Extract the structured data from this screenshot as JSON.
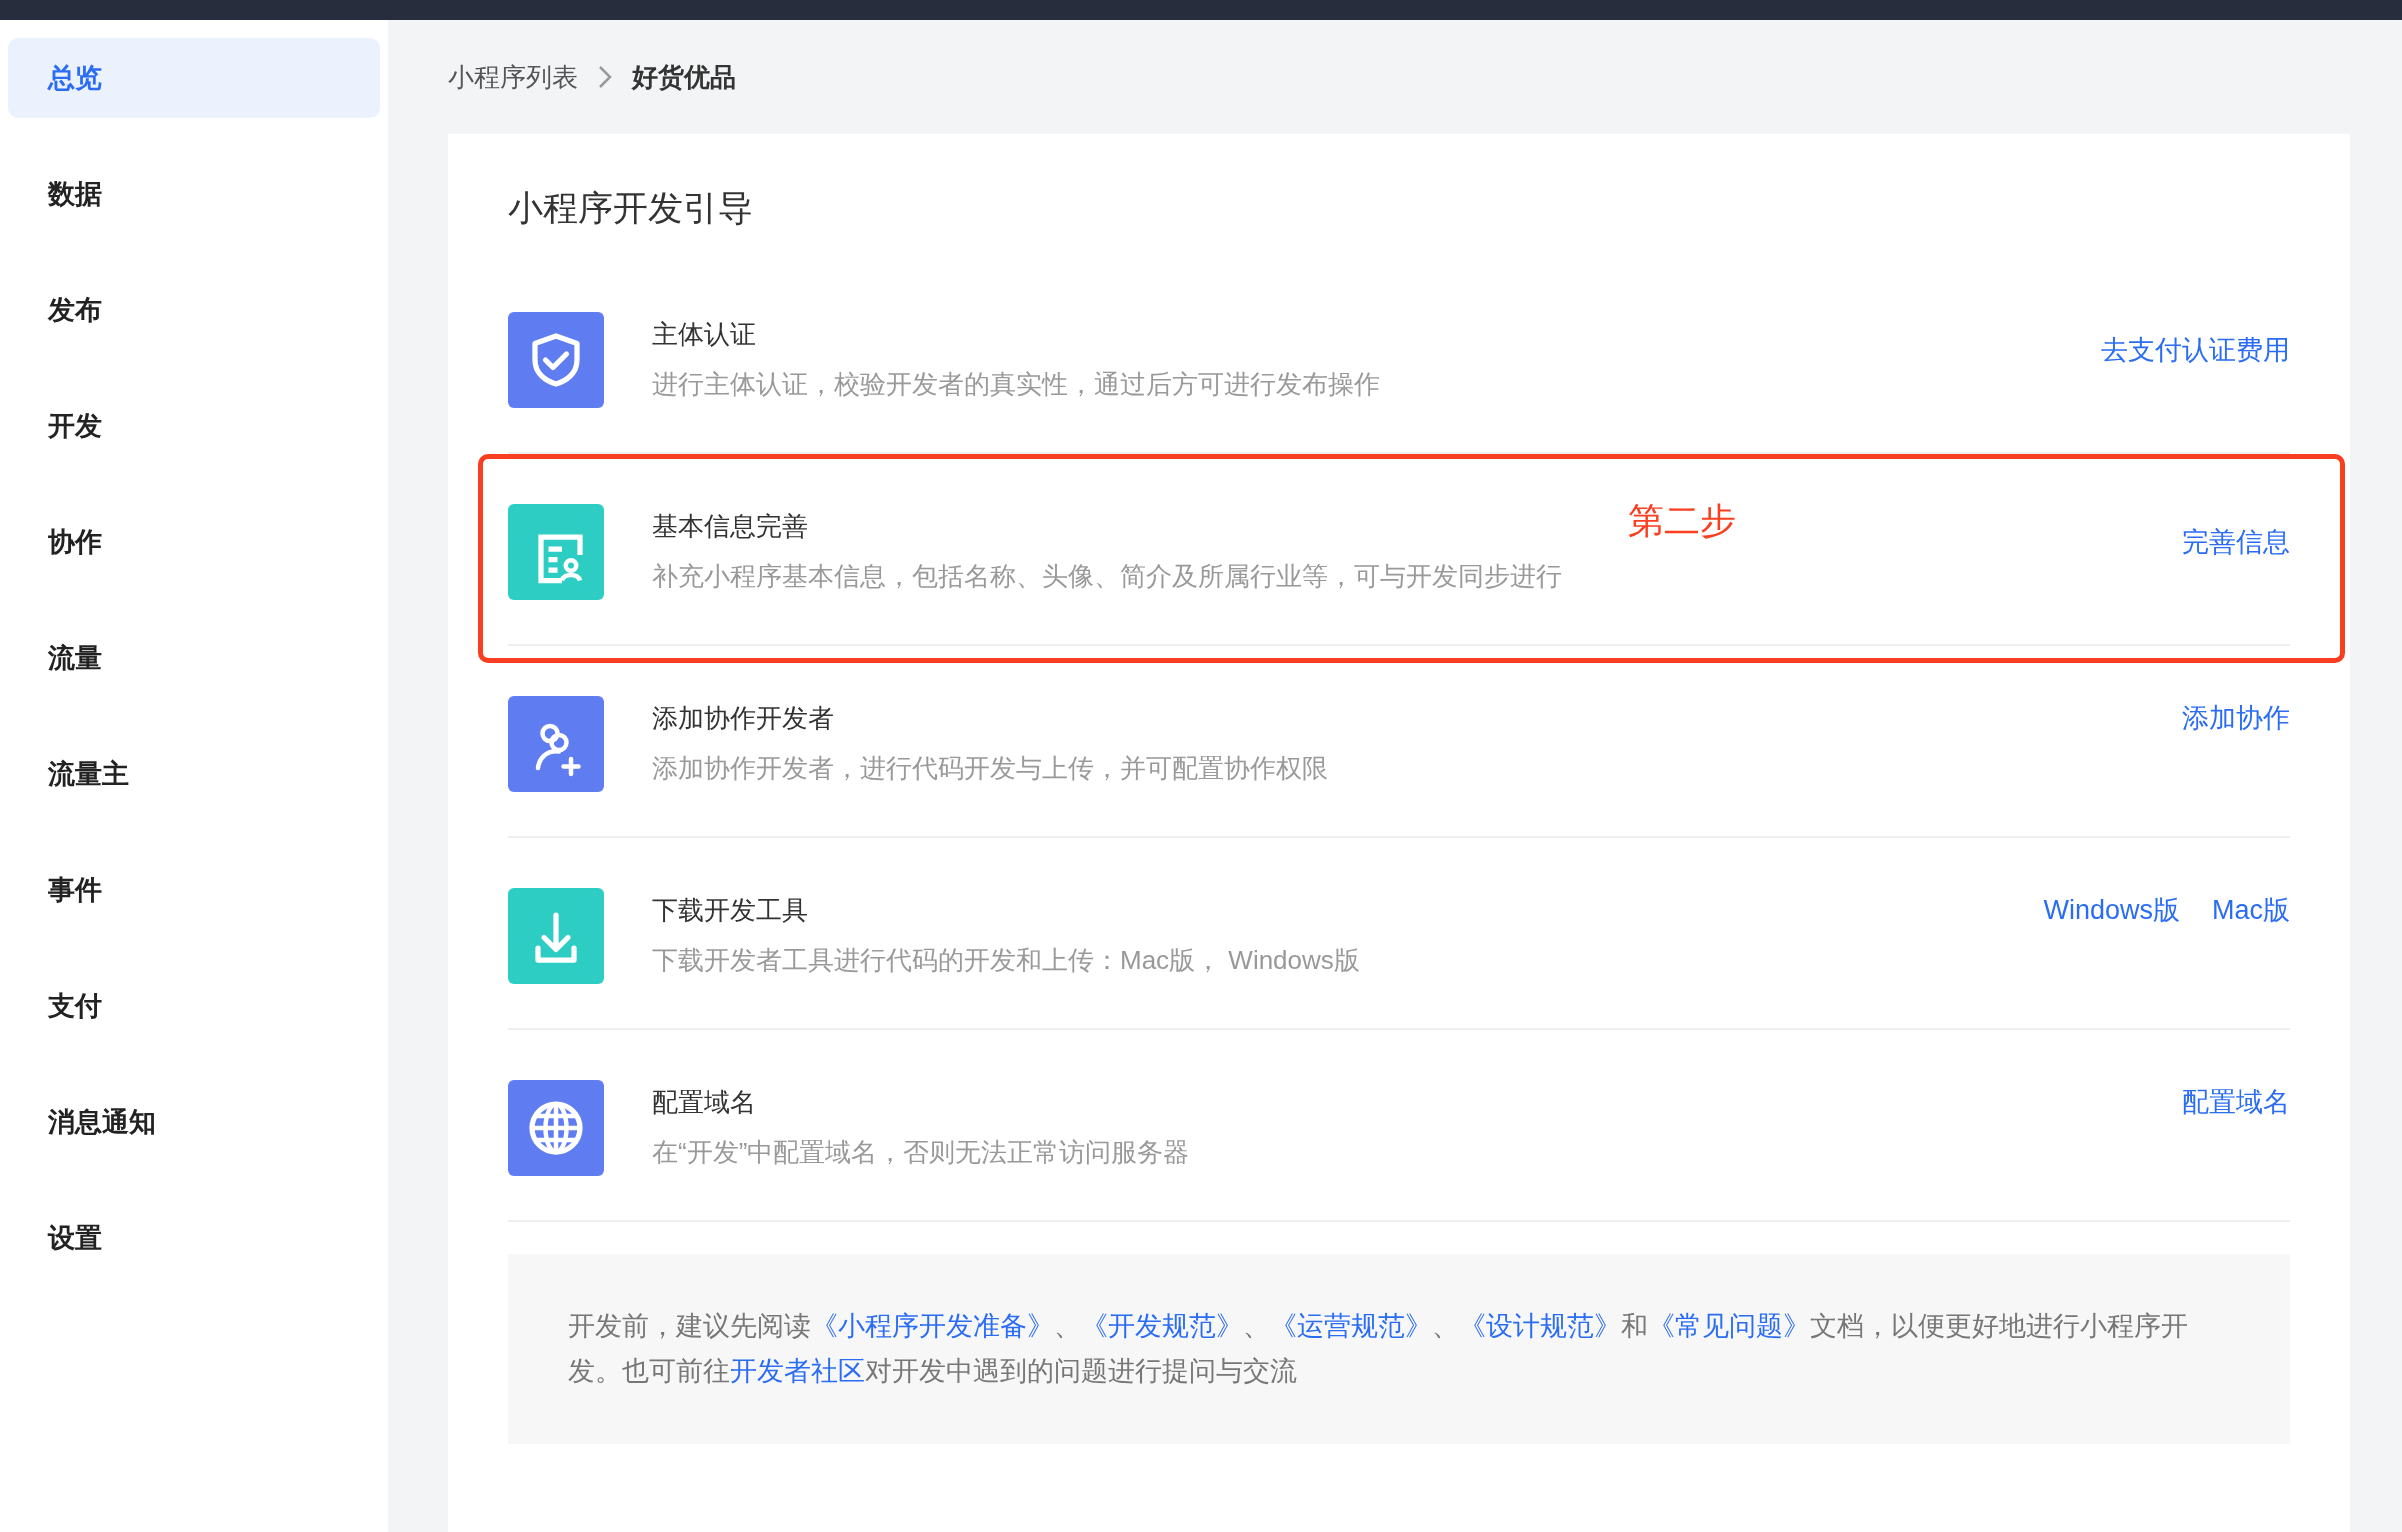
{
  "sidebar": {
    "items": [
      {
        "label": "总览",
        "selected": true
      },
      {
        "label": "数据",
        "selected": false
      },
      {
        "label": "发布",
        "selected": false
      },
      {
        "label": "开发",
        "selected": false
      },
      {
        "label": "协作",
        "selected": false
      },
      {
        "label": "流量",
        "selected": false
      },
      {
        "label": "流量主",
        "selected": false
      },
      {
        "label": "事件",
        "selected": false
      },
      {
        "label": "支付",
        "selected": false
      },
      {
        "label": "消息通知",
        "selected": false
      },
      {
        "label": "设置",
        "selected": false
      }
    ]
  },
  "breadcrumb": [
    "小程序列表",
    "好货优品"
  ],
  "guide": {
    "title": "小程序开发引导",
    "steps": [
      {
        "kind": "shield",
        "color": "#5f7cf1",
        "title": "主体认证",
        "description": "进行主体认证，校验开发者的真实性，通过后方可进行发布操作",
        "links": [
          "去支付认证费用"
        ]
      },
      {
        "kind": "profile",
        "color": "#2ecdc4",
        "title": "基本信息完善",
        "description": "补充小程序基本信息，包括名称、头像、简介及所属行业等，可与开发同步进行",
        "links": [
          "完善信息"
        ],
        "annotation": "第二步"
      },
      {
        "kind": "users",
        "color": "#5f7cf1",
        "title": "添加协作开发者",
        "description": "添加协作开发者，进行代码开发与上传，并可配置协作权限",
        "links": [
          "添加协作"
        ]
      },
      {
        "kind": "download",
        "color": "#2ecdc4",
        "title": "下载开发工具",
        "description": "下载开发者工具进行代码的开发和上传：Mac版， Windows版",
        "links": [
          "Windows版",
          "Mac版"
        ]
      },
      {
        "kind": "globe",
        "color": "#5f7cf1",
        "title": "配置域名",
        "description": "在“开发”中配置域名，否则无法正常访问服务器",
        "links": [
          "配置域名"
        ]
      }
    ],
    "notice": [
      {
        "text": "开发前，建议先阅读",
        "link": false
      },
      {
        "text": "《小程序开发准备》",
        "link": true
      },
      {
        "text": "、",
        "link": false
      },
      {
        "text": "《开发规范》",
        "link": true
      },
      {
        "text": "、",
        "link": false
      },
      {
        "text": "《运营规范》",
        "link": true
      },
      {
        "text": "、",
        "link": false
      },
      {
        "text": "《设计规范》",
        "link": true
      },
      {
        "text": "和",
        "link": false
      },
      {
        "text": "《常见问题》",
        "link": true
      },
      {
        "text": "文档，以便更好地进行小程序开发。也可前往",
        "link": false
      },
      {
        "text": "开发者社区",
        "link": true
      },
      {
        "text": "对开发中遇到的问题进行提问与交流",
        "link": false
      }
    ]
  }
}
